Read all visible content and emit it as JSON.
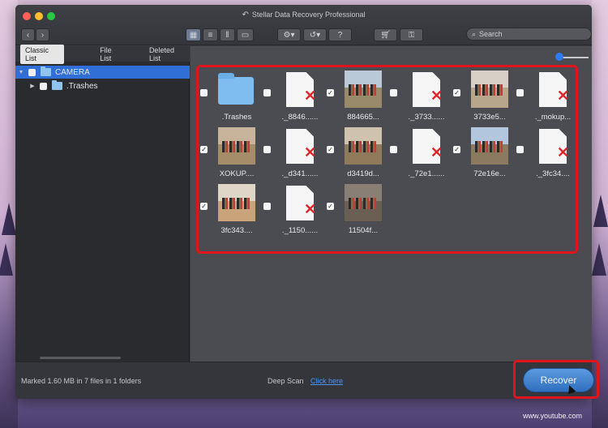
{
  "window": {
    "title": "Stellar Data Recovery Professional"
  },
  "toolbar": {
    "search_placeholder": "Search",
    "help_label": "?"
  },
  "sidebar": {
    "tabs": [
      {
        "label": "Classic List",
        "selected": true
      },
      {
        "label": "File List",
        "selected": false
      },
      {
        "label": "Deleted List",
        "selected": false
      }
    ],
    "tree": [
      {
        "label": "CAMERA",
        "selected": true
      },
      {
        "label": ".Trashes",
        "selected": false
      }
    ]
  },
  "files": [
    {
      "name": ".Trashes",
      "kind": "folder",
      "checked": false
    },
    {
      "name": "._8846......",
      "kind": "deleted",
      "checked": false
    },
    {
      "name": "884665...",
      "kind": "photo",
      "checked": true
    },
    {
      "name": "._3733......",
      "kind": "deleted",
      "checked": false
    },
    {
      "name": "3733e5...",
      "kind": "photo",
      "checked": true
    },
    {
      "name": "._mokup...",
      "kind": "deleted",
      "checked": false
    },
    {
      "name": "XOKUP....",
      "kind": "photo",
      "checked": true
    },
    {
      "name": "._d341......",
      "kind": "deleted",
      "checked": false
    },
    {
      "name": "d3419d...",
      "kind": "photo",
      "checked": true
    },
    {
      "name": "._72e1......",
      "kind": "deleted",
      "checked": false
    },
    {
      "name": "72e16e...",
      "kind": "photo",
      "checked": true
    },
    {
      "name": "._3fc34....",
      "kind": "deleted",
      "checked": false
    },
    {
      "name": "3fc343....",
      "kind": "photo",
      "checked": true
    },
    {
      "name": "._1150......",
      "kind": "deleted",
      "checked": false
    },
    {
      "name": "11504f...",
      "kind": "photo",
      "checked": true
    }
  ],
  "status": {
    "marked_text": "Marked 1.60 MB in 7 files in 1 folders",
    "deep_scan_label": "Deep Scan",
    "deep_scan_link": "Click here"
  },
  "actions": {
    "recover_label": "Recover"
  },
  "watermark": "www.youtube.com",
  "colors": {
    "accent": "#2f6fd6",
    "highlight": "#e0141c",
    "deleted_mark": "#e0252a"
  }
}
